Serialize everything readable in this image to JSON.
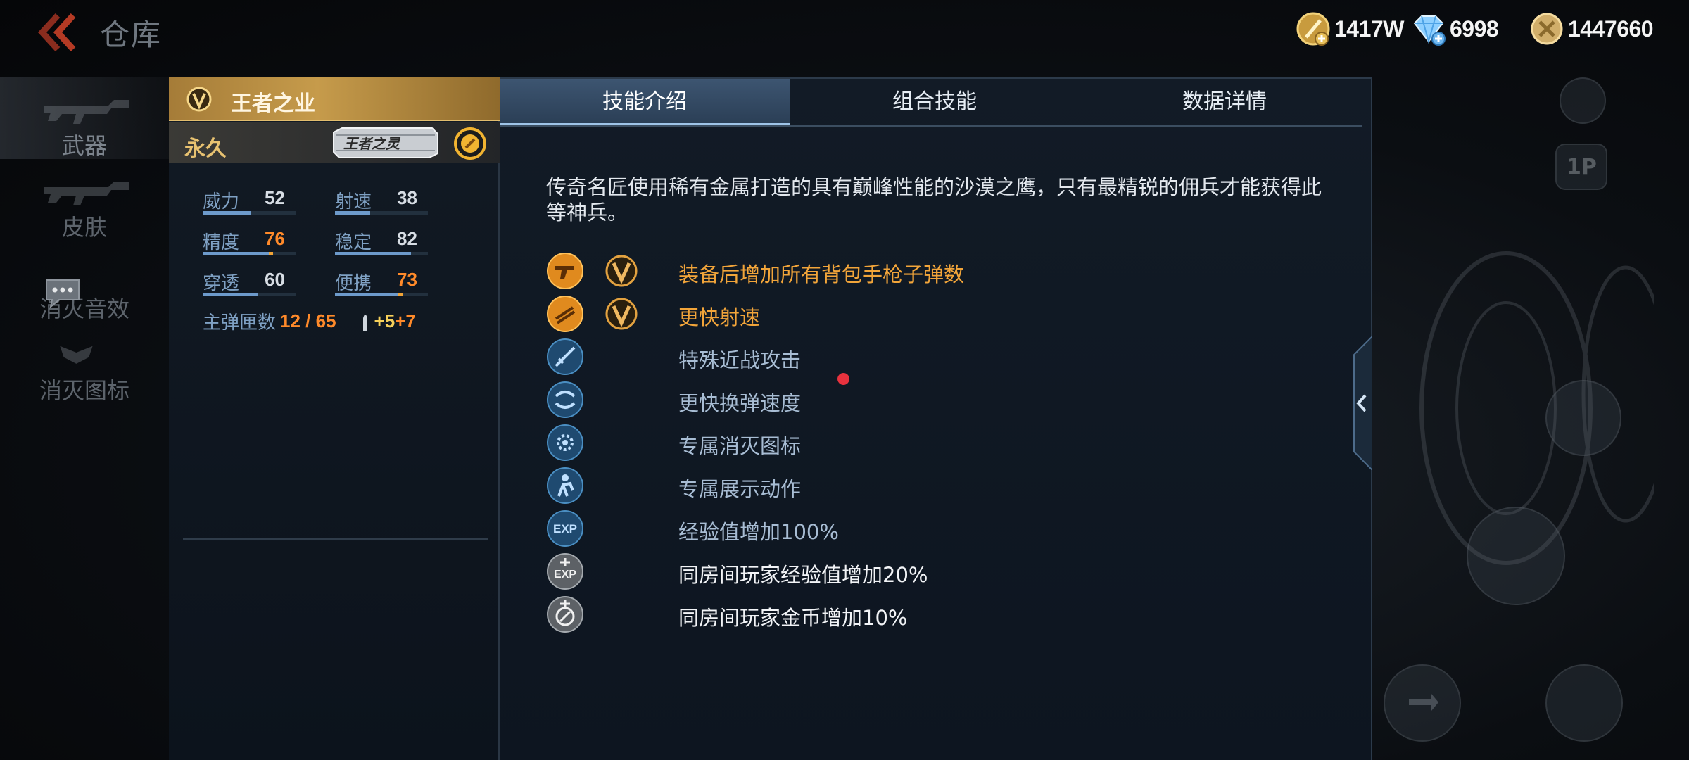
{
  "header": {
    "title": "仓库",
    "currencies": [
      {
        "icon": "gold-coin-icon",
        "value": "1417W"
      },
      {
        "icon": "diamond-icon",
        "value": "6998"
      },
      {
        "icon": "honor-coin-icon",
        "value": "1447660"
      }
    ]
  },
  "sidebar": {
    "items": [
      {
        "label": "武器",
        "active": true
      },
      {
        "label": "皮肤",
        "active": false
      },
      {
        "label": "消灭音效",
        "active": false
      },
      {
        "label": "消灭图标",
        "active": false
      }
    ]
  },
  "weapon": {
    "name": "王者之业",
    "duration": "永久",
    "badge_text": "王者之灵",
    "stats": {
      "power": {
        "label": "威力",
        "value": "52",
        "level": 0.52
      },
      "fire_rate": {
        "label": "射速",
        "value": "38",
        "level": 0.38
      },
      "accuracy": {
        "label": "精度",
        "value": "76",
        "level": 0.76
      },
      "stability": {
        "label": "稳定",
        "value": "82",
        "level": 0.82
      },
      "penetration": {
        "label": "穿透",
        "value": "60",
        "level": 0.6
      },
      "portability": {
        "label": "便携",
        "value": "73",
        "level": 0.73
      }
    },
    "ammo": {
      "label": "主弹匣数",
      "value": "12 / 65",
      "bonus1": "+5",
      "bonus2": "+7"
    }
  },
  "tabs": [
    {
      "label": "技能介绍",
      "active": true
    },
    {
      "label": "组合技能",
      "active": false
    },
    {
      "label": "数据详情",
      "active": false
    }
  ],
  "description": "传奇名匠使用稀有金属打造的具有巅峰性能的沙漠之鹰，只有最精锐的佣兵才能获得此等神兵。",
  "skills": [
    {
      "icon": "pistol-ammo-icon",
      "has_v_badge": true,
      "text": "装备后增加所有背包手枪子弹数",
      "color": "gold"
    },
    {
      "icon": "fire-rate-icon",
      "has_v_badge": true,
      "text": "更快射速",
      "color": "gold"
    },
    {
      "icon": "melee-attack-icon",
      "has_v_badge": false,
      "text": "特殊近战攻击",
      "color": "blue"
    },
    {
      "icon": "reload-speed-icon",
      "has_v_badge": false,
      "text": "更快换弹速度",
      "color": "blue"
    },
    {
      "icon": "kill-icon-icon",
      "has_v_badge": false,
      "text": "专属消灭图标",
      "color": "blue"
    },
    {
      "icon": "show-action-icon",
      "has_v_badge": false,
      "text": "专属展示动作",
      "color": "blue"
    },
    {
      "icon": "exp-icon",
      "has_v_badge": false,
      "text": "经验值增加100%",
      "color": "blue"
    },
    {
      "icon": "room-exp-icon",
      "has_v_badge": false,
      "text": "同房间玩家经验值增加20%",
      "color": "white"
    },
    {
      "icon": "room-coin-icon",
      "has_v_badge": false,
      "text": "同房间玩家金币增加10%",
      "color": "white"
    }
  ],
  "background_controls": {
    "view_1p_label": "1P"
  },
  "colors": {
    "gold_text": "#f2a53a",
    "blue_text": "#a8bdd4",
    "orange_value": "#ff8a2a",
    "tab_active": "#3d5571"
  }
}
